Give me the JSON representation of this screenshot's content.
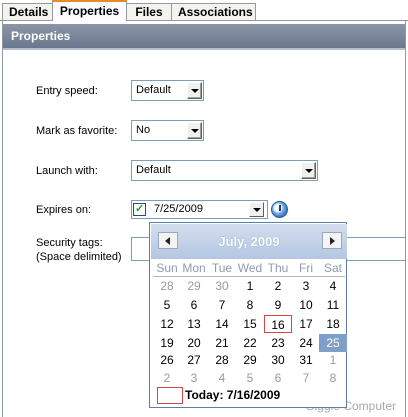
{
  "tabs": [
    {
      "label": "Details"
    },
    {
      "label": "Properties"
    },
    {
      "label": "Files"
    },
    {
      "label": "Associations"
    }
  ],
  "header": {
    "title": "Properties"
  },
  "form": {
    "entry_speed": {
      "label": "Entry speed:",
      "value": "Default"
    },
    "favorite": {
      "label": "Mark as favorite:",
      "value": "No"
    },
    "launch_with": {
      "label": "Launch with:",
      "value": "Default"
    },
    "expires": {
      "label": "Expires on:",
      "value": "7/25/2009"
    },
    "security_tags": {
      "label_line1": "Security tags:",
      "label_line2": "(Space delimited)"
    }
  },
  "calendar": {
    "title": "July, 2009",
    "weekdays": [
      "Sun",
      "Mon",
      "Tue",
      "Wed",
      "Thu",
      "Fri",
      "Sat"
    ],
    "weeks": [
      [
        "28",
        "29",
        "30",
        "1",
        "2",
        "3",
        "4"
      ],
      [
        "5",
        "6",
        "7",
        "8",
        "9",
        "10",
        "11"
      ],
      [
        "12",
        "13",
        "14",
        "15",
        "16",
        "17",
        "18"
      ],
      [
        "19",
        "20",
        "21",
        "22",
        "23",
        "24",
        "25"
      ],
      [
        "26",
        "27",
        "28",
        "29",
        "30",
        "31",
        "1"
      ],
      [
        "2",
        "3",
        "4",
        "5",
        "6",
        "7",
        "8"
      ]
    ],
    "today_label": "Today: 7/16/2009"
  },
  "watermark": "Giggle Computer"
}
